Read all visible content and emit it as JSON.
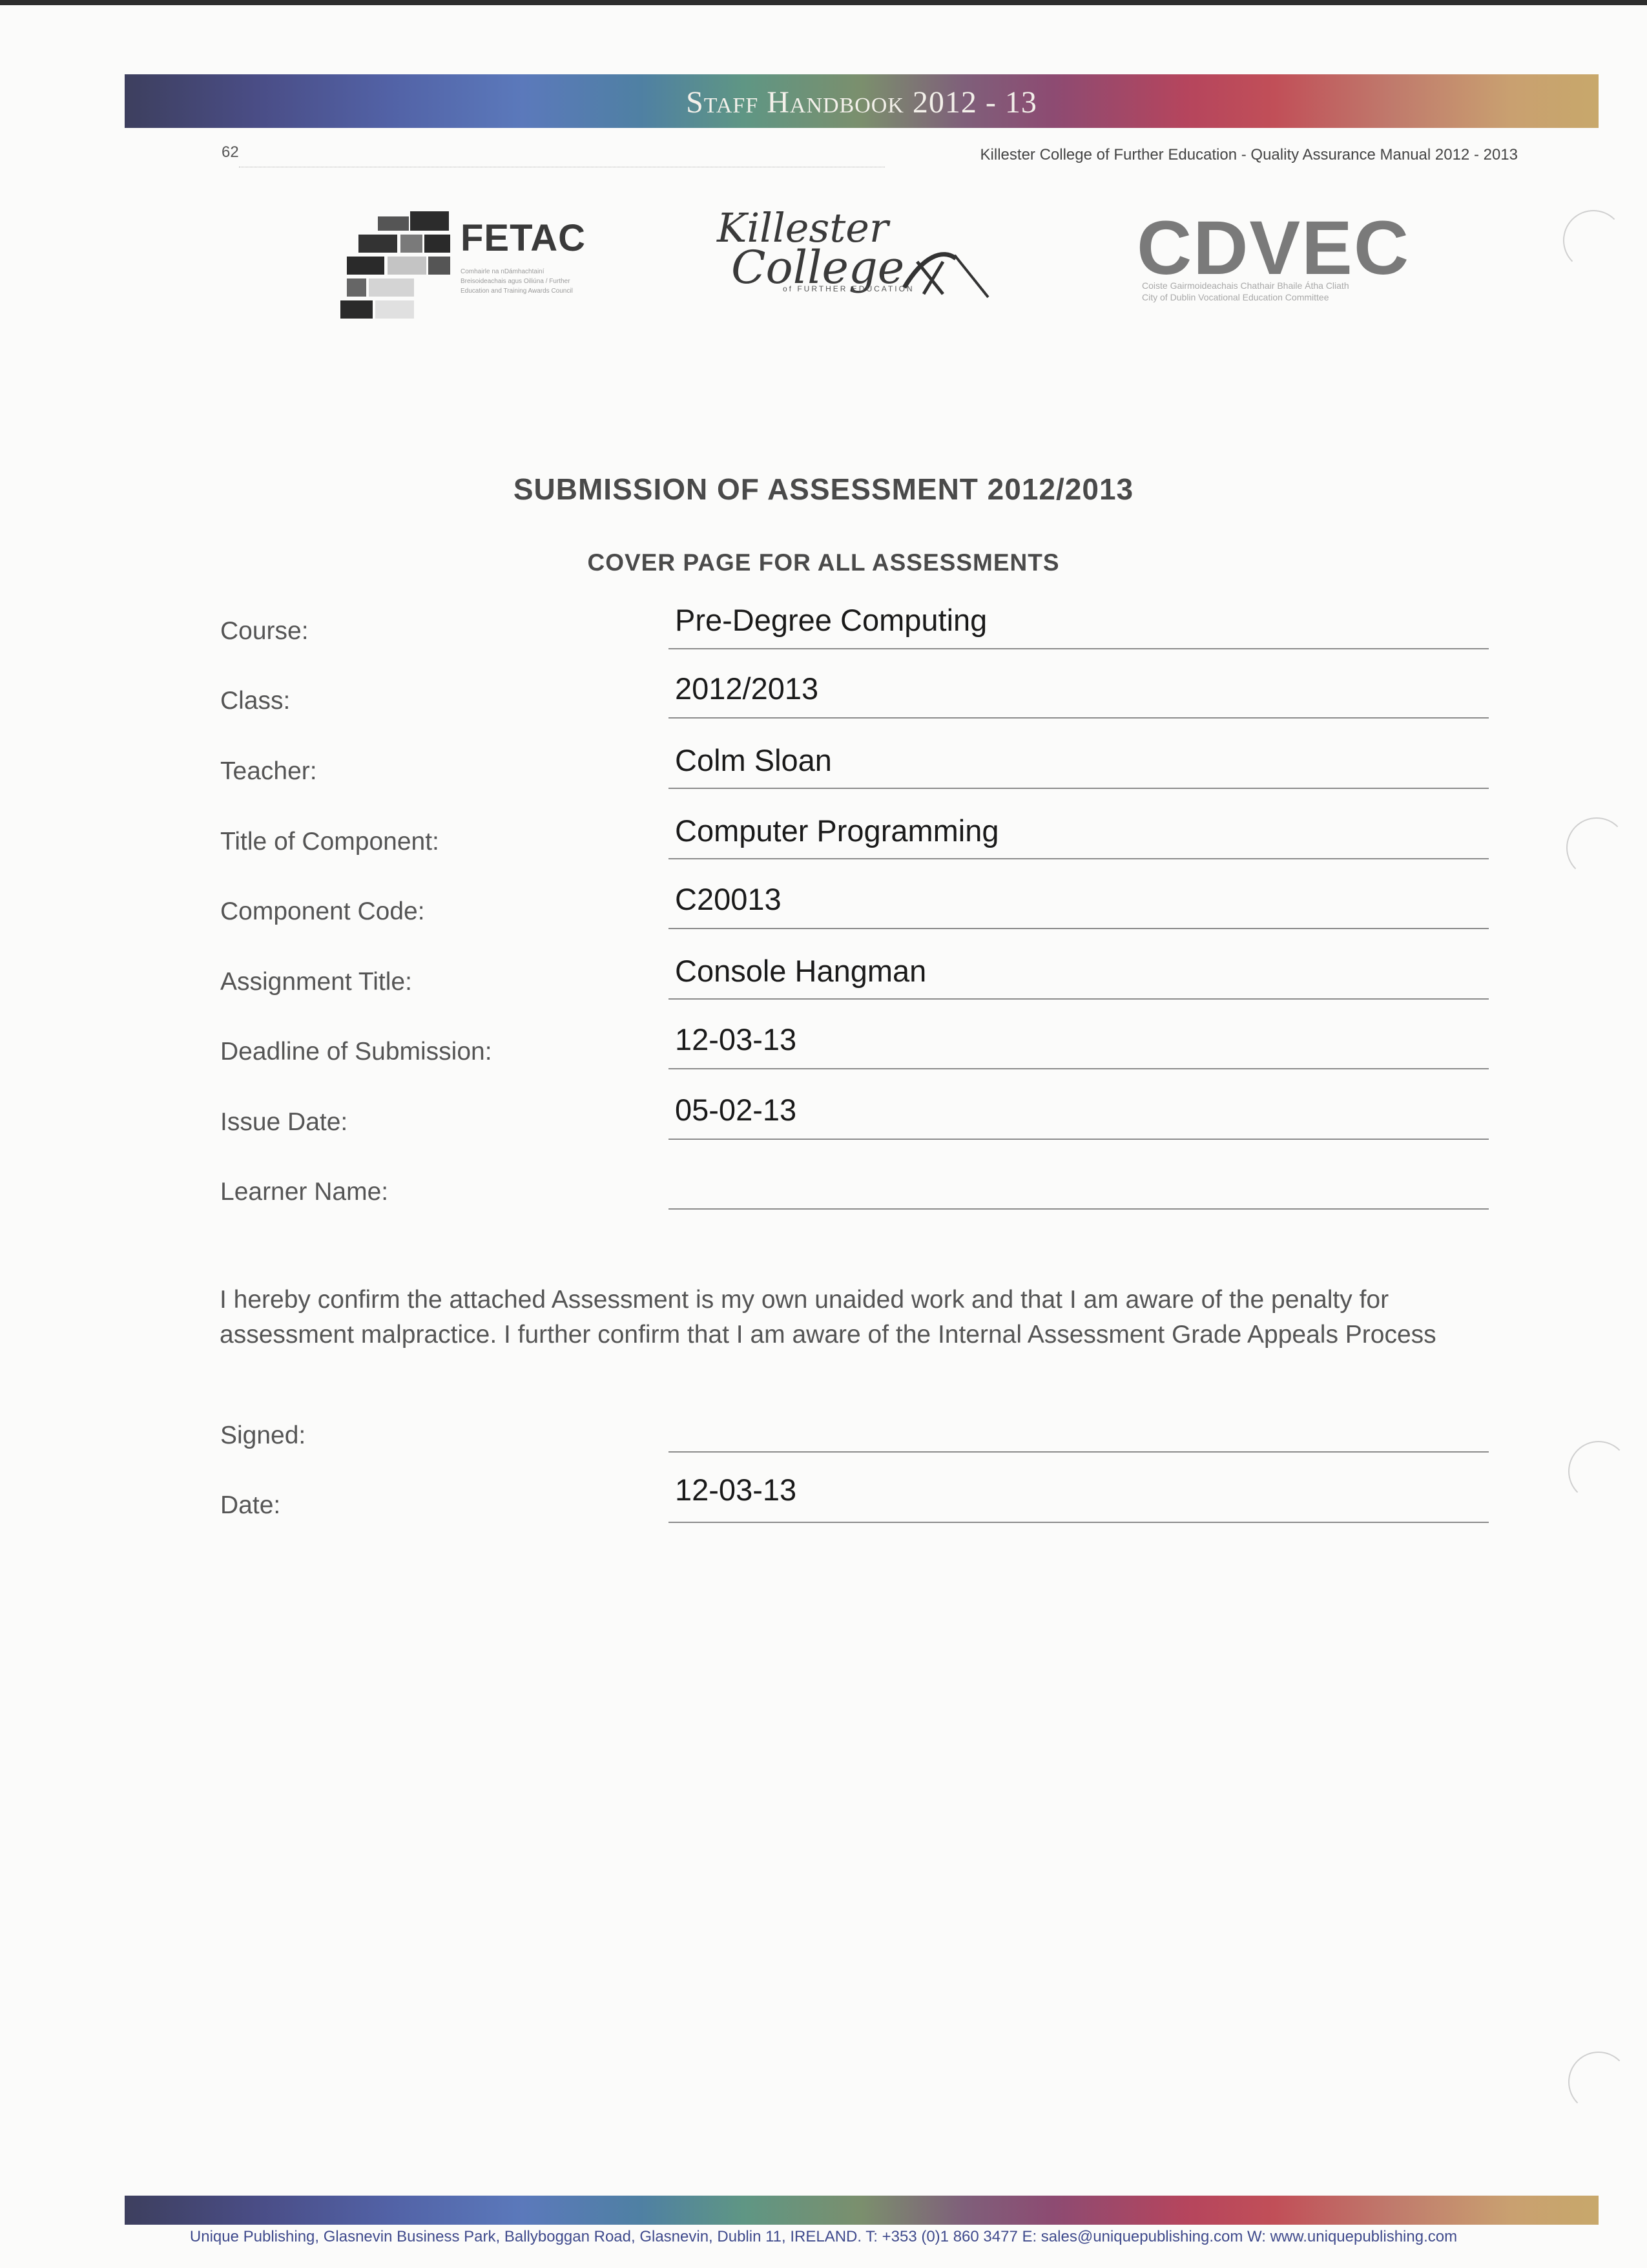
{
  "header": {
    "band_title": "Staff Handbook 2012 - 13",
    "page_number": "62",
    "manual_title": "Killester College of Further Education - Quality Assurance Manual 2012 - 2013"
  },
  "logos": {
    "fetac": {
      "name": "FETAC",
      "tagline": "Comhairle na nDámhachtainí Breisoideachais agus Oiliúna / Further Education and Training Awards Council"
    },
    "killester": {
      "line1": "Killester",
      "line2": "College",
      "tagline": "of FURTHER EDUCATION"
    },
    "cdvec": {
      "name": "CDVEC",
      "tagline_ga": "Coiste Gairmoideachais Chathair Bhaile Átha Cliath",
      "tagline_en": "City of Dublin Vocational Education Committee"
    }
  },
  "document": {
    "title": "SUBMISSION OF ASSESSMENT 2012/2013",
    "subtitle": "COVER PAGE FOR ALL ASSESSMENTS"
  },
  "fields": [
    {
      "label": "Course:",
      "value": "Pre-Degree Computing"
    },
    {
      "label": "Class:",
      "value": "2012/2013"
    },
    {
      "label": "Teacher:",
      "value": "Colm Sloan"
    },
    {
      "label": "Title of Component:",
      "value": "Computer Programming"
    },
    {
      "label": "Component Code:",
      "value": "C20013"
    },
    {
      "label": "Assignment Title:",
      "value": "Console Hangman"
    },
    {
      "label": "Deadline of Submission:",
      "value": "12-03-13"
    },
    {
      "label": "Issue Date:",
      "value": "05-02-13"
    },
    {
      "label": "Learner Name:",
      "value": ""
    }
  ],
  "declaration": "I hereby confirm the attached Assessment is my own unaided work and that I am aware of the penalty for assessment malpractice.  I further confirm that I am aware of the Internal Assessment Grade Appeals Process",
  "signoff": [
    {
      "label": "Signed:",
      "value": ""
    },
    {
      "label": "Date:",
      "value": "12-03-13"
    }
  ],
  "footer": "Unique Publishing, Glasnevin Business Park, Ballyboggan Road, Glasnevin, Dublin 11, IRELAND.  T: +353 (0)1 860 3477  E: sales@uniquepublishing.com   W: www.uniquepublishing.com"
}
